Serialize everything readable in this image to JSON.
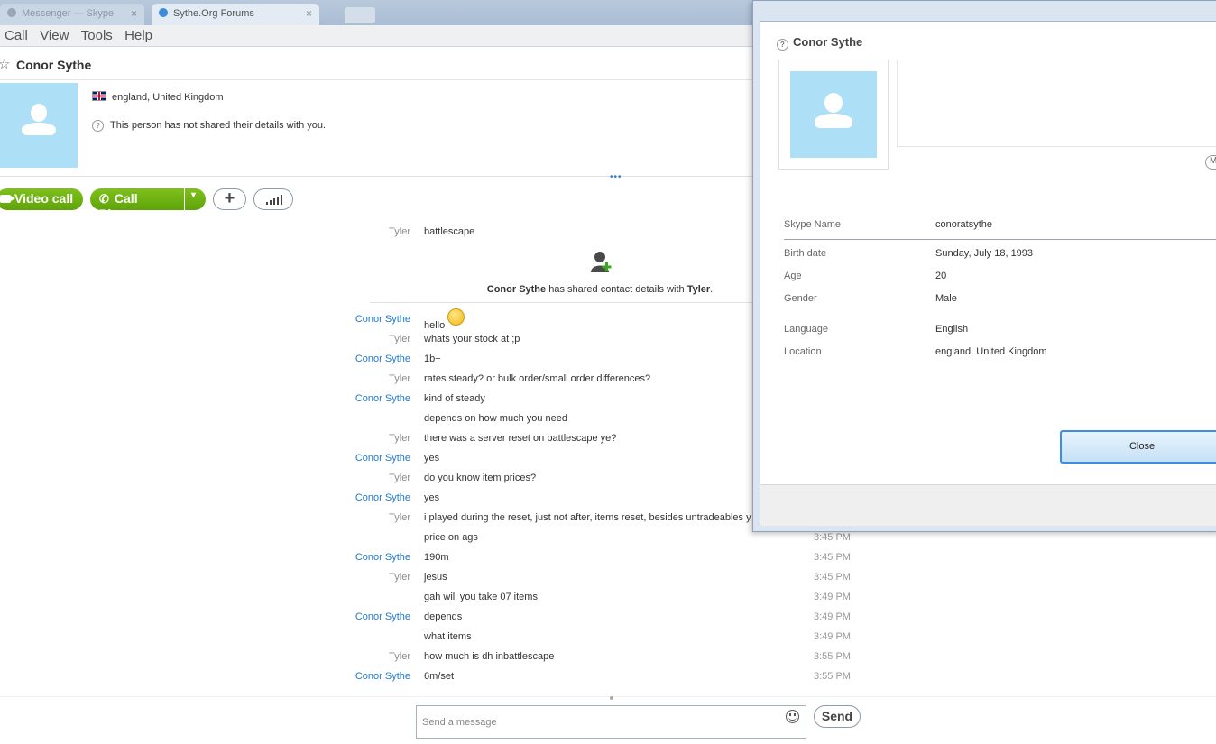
{
  "browser": {
    "tabs": [
      {
        "label": "Messenger — Skype"
      },
      {
        "label": "Sythe.Org Forums"
      }
    ],
    "tab_close": "×"
  },
  "menu": [
    "Call",
    "View",
    "Tools",
    "Help"
  ],
  "contact": {
    "name": "Conor Sythe",
    "location": "england, United Kingdom",
    "privacy_note": "This person has not shared their details with you."
  },
  "call_bar": {
    "video_label": "Video call",
    "phone_label": "Call Phone",
    "dropdown_glyph": "▾",
    "add_glyph": "+"
  },
  "chat": {
    "first": {
      "sender": "Tyler",
      "text": "battlescape"
    },
    "shared": {
      "sender": "Conor Sythe",
      "middle": " has shared contact details with ",
      "target": "Tyler",
      "end": "."
    },
    "messages": [
      {
        "sender": "Conor Sythe",
        "text": "hello",
        "time": "",
        "emoticon": "smile"
      },
      {
        "sender": "Tyler",
        "text": "whats your stock at ;p",
        "time": ""
      },
      {
        "sender": "Conor Sythe",
        "text": "1b+",
        "time": ""
      },
      {
        "sender": "Tyler",
        "text": "rates steady? or bulk order/small order differences?",
        "time": ""
      },
      {
        "sender": "Conor Sythe",
        "text": "kind of steady",
        "time": ""
      },
      {
        "sender": "",
        "text": "depends on how much you need",
        "time": ""
      },
      {
        "sender": "Tyler",
        "text": "there was a server reset on battlescape ye?",
        "time": ""
      },
      {
        "sender": "Conor Sythe",
        "text": "yes",
        "time": ""
      },
      {
        "sender": "Tyler",
        "text": "do you know item prices?",
        "time": ""
      },
      {
        "sender": "Conor Sythe",
        "text": "yes",
        "time": ""
      },
      {
        "sender": "Tyler",
        "text": "i played during the reset, just not after, items reset, besides untradeables y",
        "time": ""
      },
      {
        "sender": "",
        "text": "price on ags",
        "time": "3:45 PM"
      },
      {
        "sender": "Conor Sythe",
        "text": "190m",
        "time": "3:45 PM"
      },
      {
        "sender": "Tyler",
        "text": "jesus",
        "time": "3:45 PM"
      },
      {
        "sender": "",
        "text": "gah will you take 07 items",
        "time": "3:49 PM"
      },
      {
        "sender": "Conor Sythe",
        "text": "depends",
        "time": "3:49 PM"
      },
      {
        "sender": "",
        "text": "what items",
        "time": "3:49 PM"
      },
      {
        "sender": "Tyler",
        "text": "how much is dh inbattlescape",
        "time": "3:55 PM"
      },
      {
        "sender": "Conor Sythe",
        "text": "6m/set",
        "time": "3:55 PM"
      }
    ]
  },
  "composer": {
    "placeholder": "Send a message",
    "send_label": "Send"
  },
  "profile": {
    "title": "Conor Sythe",
    "more_label": "M",
    "fields": [
      {
        "label": "Skype Name",
        "value": "conoratsythe"
      },
      {
        "label": "Birth date",
        "value": "Sunday, July 18, 1993"
      },
      {
        "label": "Age",
        "value": "20"
      },
      {
        "label": "Gender",
        "value": "Male"
      },
      {
        "label": "Language",
        "value": "English"
      },
      {
        "label": "Location",
        "value": "england, United Kingdom"
      }
    ],
    "close_label": "Close"
  },
  "colors": {
    "accent_green": "#6cb312",
    "sender_blue": "#1d7ad0",
    "avatar_blue": "#ade0f7"
  }
}
